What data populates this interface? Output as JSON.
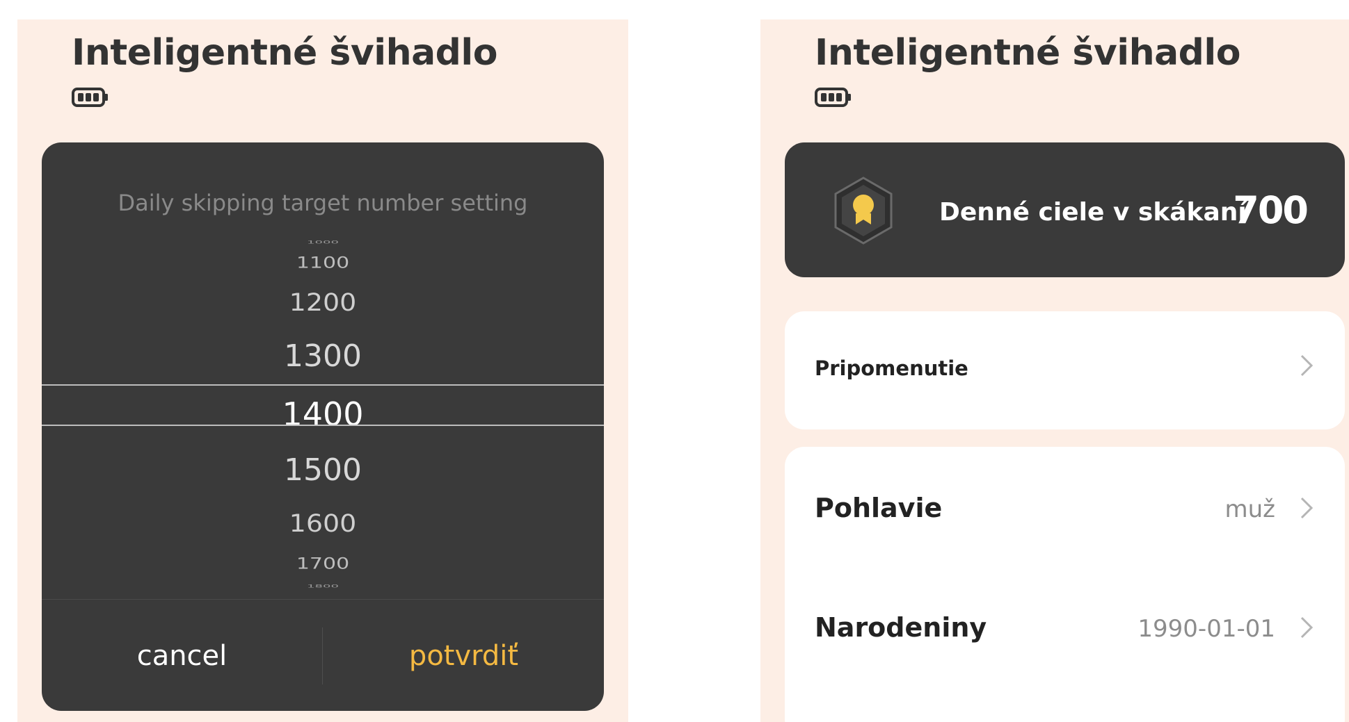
{
  "left_screen": {
    "title": "Inteligentné švihadlo",
    "battery_icon": "battery-full-icon",
    "picker": {
      "title": "Daily skipping target number setting",
      "items": [
        "1000",
        "1100",
        "1200",
        "1300",
        "1400",
        "1500",
        "1600",
        "1700",
        "1800"
      ],
      "selected": "1400",
      "cancel_label": "cancel",
      "confirm_label": "potvrdiť"
    }
  },
  "right_screen": {
    "title": "Inteligentné švihadlo",
    "battery_icon": "battery-full-icon",
    "goal": {
      "label": "Denné ciele v skákaní",
      "value": "700",
      "icon": "medal-badge-icon"
    },
    "reminder": {
      "label": "Pripomenutie"
    },
    "profile": {
      "gender_label": "Pohlavie",
      "gender_value": "muž",
      "birthday_label": "Narodeniny",
      "birthday_value": "1990-01-01"
    }
  },
  "colors": {
    "panel_background": "#fdeee5",
    "card_dark": "#3a3a3a",
    "accent": "#f4b942",
    "text_dark": "#333333"
  }
}
